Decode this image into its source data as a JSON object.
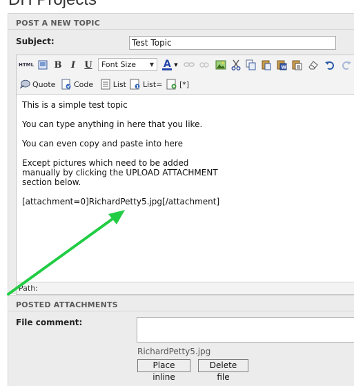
{
  "page": {
    "title": "DH Projects"
  },
  "post_panel": {
    "title": "POST A NEW TOPIC",
    "subject_label": "Subject:",
    "subject_value": "Test Topic"
  },
  "toolbar": {
    "font_size_label": "Font Size",
    "row1_icons": [
      "html-icon",
      "image-icon",
      "bold-icon",
      "italic-icon",
      "underline-icon",
      "font-color-icon",
      "link-icon",
      "unlink-icon",
      "insert-image-icon",
      "cut-icon",
      "copy-icon",
      "paste-icon",
      "paste-word-icon",
      "paste-text-icon",
      "eraser-icon",
      "undo-icon",
      "redo-icon"
    ],
    "bold": "B",
    "italic": "I",
    "underline": "U",
    "html": "HTML",
    "font_color": "A",
    "quote_label": "Quote",
    "code_label": "Code",
    "list_label": "List",
    "list_ordered_label": "List=",
    "list_item_label": "[*]"
  },
  "editor": {
    "lines": [
      "This is a simple test topic",
      "You can type anything in here that you like.",
      "You can even copy and paste into here",
      "Except pictures which need to be added\nmanually by clicking the UPLOAD ATTACHMENT\nsection below.",
      "[attachment=0]RichardPetty5.jpg[/attachment]"
    ],
    "path_label": "Path:"
  },
  "attachments_panel": {
    "title": "POSTED ATTACHMENTS",
    "file_comment_label": "File comment:",
    "file_comment_value": "",
    "filename": "RichardPetty5.jpg",
    "place_inline_label": "Place inline",
    "delete_file_label": "Delete file"
  },
  "colors": {
    "panel_bg": "#ececec",
    "annotation_arrow": "#22cc44",
    "font_color_bar": "#2244aa"
  }
}
